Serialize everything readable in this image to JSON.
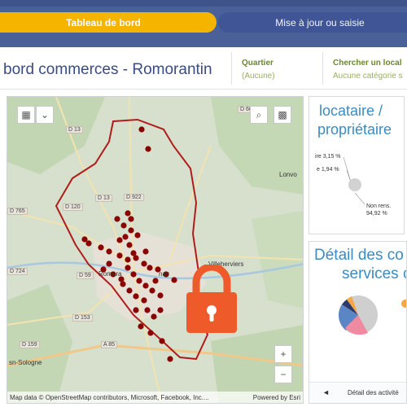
{
  "nav": {
    "tab_dashboard": "Tableau de bord",
    "tab_update": "Mise à jour ou saisie"
  },
  "header": {
    "title": "bord commerces - Romorantin",
    "filter_quartier_label": "Quartier",
    "filter_quartier_value": "(Aucune)",
    "filter_search_label": "Chercher un local",
    "filter_search_value": "Aucune catégorie s"
  },
  "map": {
    "labels": {
      "d13": "D 13",
      "d60": "D 60",
      "d922": "D 922",
      "d120": "D 120",
      "d765": "D 765",
      "d724": "D 724",
      "d59": "D 59",
      "d153": "D 153",
      "a85": "A 85",
      "d159": "D 159",
      "lonvo": "Lonvo",
      "villeherviers": "Villeherviers",
      "romorantin": "Romora",
      "lanthenay": "nay",
      "sologne": "sn-Sologne"
    },
    "attribution": "Map data © OpenStreetMap contributors, Microsoft, Facebook, Inc....",
    "powered": "Powered by Esri",
    "zoom_in": "+",
    "zoom_out": "−",
    "colors": {
      "boundary": "#b01c1c",
      "points": "#8b0000"
    }
  },
  "tenure_card": {
    "title_line1": "locataire /",
    "title_line2": "propriétaire",
    "label_a": "ire 3,15 %",
    "label_b": "e 1,94 %",
    "label_c_line1": "Non rens.",
    "label_c_line2": "94,92 %"
  },
  "services_card": {
    "title_line1": "Détail des co",
    "title_line2": "services c",
    "footer": "Détail des activité",
    "nav_prev": "◄"
  },
  "lock_overlay": {
    "color": "#ef5a2a"
  },
  "icons": {
    "basemap": "basemap-gallery-icon",
    "chevron": "chevron-down-icon",
    "search": "search-icon",
    "qr": "qr-code-icon",
    "lock": "lock-icon"
  }
}
